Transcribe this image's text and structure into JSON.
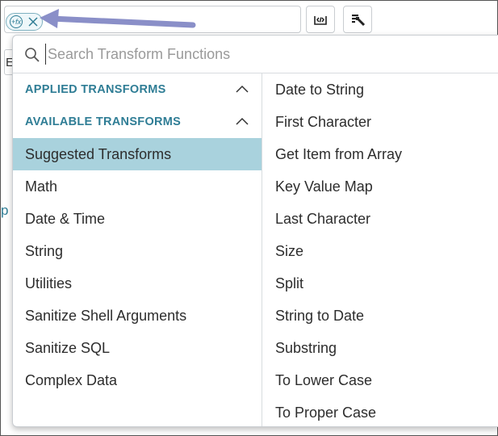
{
  "background": {
    "field_text": "Ette",
    "side_text": "p"
  },
  "chip": {
    "fx_label": "+fx",
    "remove_icon": "close-icon"
  },
  "toolbar": {
    "code_icon": "code-tag-icon",
    "mapping_icon": "list-wand-icon"
  },
  "search": {
    "icon": "search-icon",
    "placeholder": "Search Transform Functions",
    "value": ""
  },
  "sections": {
    "applied": "APPLIED TRANSFORMS",
    "available": "AVAILABLE TRANSFORMS"
  },
  "categories": [
    "Suggested Transforms",
    "Math",
    "Date & Time",
    "String",
    "Utilities",
    "Sanitize Shell Arguments",
    "Sanitize SQL",
    "Complex Data"
  ],
  "selected_category": "Suggested Transforms",
  "functions": [
    "Date to String",
    "First Character",
    "Get Item from Array",
    "Key Value Map",
    "Last Character",
    "Size",
    "Split",
    "String to Date",
    "Substring",
    "To Lower Case",
    "To Proper Case"
  ],
  "colors": {
    "accent": "#2f7d95",
    "selected_bg": "#a9d2dd",
    "annotation_arrow": "#8a8fc8"
  }
}
